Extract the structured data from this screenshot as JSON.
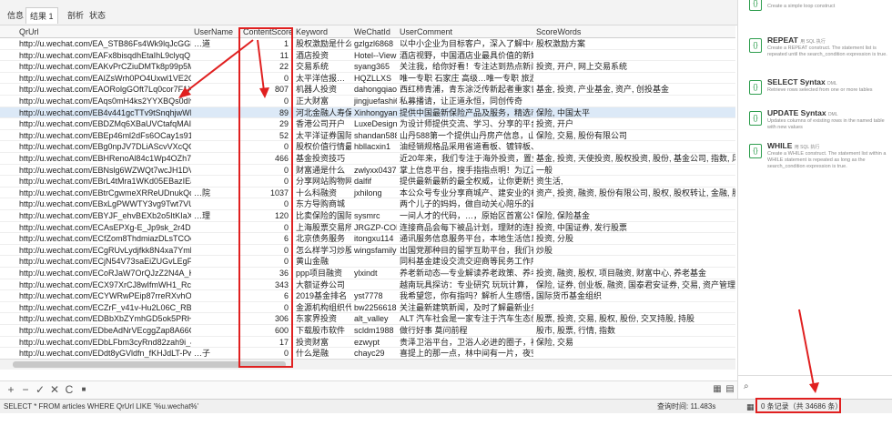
{
  "tabs": [
    "信息",
    "结果 1",
    "剖析",
    "状态"
  ],
  "active_tab": 1,
  "columns": {
    "qrurl": "QrUrl",
    "username": "UserName",
    "score": "ContentScore",
    "keyword": "Keyword",
    "wechatid": "WeChatId",
    "comment": "UserComment",
    "scorewords": "ScoreWords"
  },
  "rows": [
    {
      "url": "http://u.wechat.com/EA_STB86Fs4Wk9lqJcGGB0",
      "user": "…道",
      "score": "1",
      "kw": "股权激励是什么意思",
      "wc": "gzlgzl6868",
      "comment": "以中小企业为目标客户，深入了解中小企业在股权激",
      "sw": "股权激励方案"
    },
    {
      "url": "http://u.wechat.com/EAFx8bisqdhEtaIhL9clyqQ",
      "user": "",
      "score": "11",
      "kw": "酒店投资",
      "wc": "Hotel--View",
      "comment": "酒店视野，中国酒店业最具价值的新媒体，专注于投资",
      "sw": ""
    },
    {
      "url": "http://u.wechat.com/EAKvPrCZiuDMTk8p99p5MicU",
      "user": "",
      "score": "22",
      "kw": "交易系统",
      "wc": "syang365",
      "comment": "关注我，给你好看！专注达到热点新闻追踪与报道，投资",
      "sw": "投资, 开户, 网上交易系统"
    },
    {
      "url": "http://u.wechat.com/EAIZsWrh0PO4Uxwl1VE2OV4",
      "user": "",
      "score": "0",
      "kw": "太平洋信报…",
      "wc": "HQZLLXS",
      "comment": "唯一专职 石家庄 高级…唯一专职 旅游网，唯一专职 1",
      "sw": ""
    },
    {
      "url": "http://u.wechat.com/EAORolgGOft7Lq0cor7F1XU",
      "user": "",
      "score": "807",
      "kw": "机器人投资",
      "wc": "dahongqiao88",
      "comment": "西红柿青浦，青东涂泛传新起者重家青西及大红桥",
      "sw": "基金, 投资, 产业基金, 资产, 创投基金"
    },
    {
      "url": "http://u.wechat.com/EAqs0mH4ks2YYXBQs0dIvYZ8",
      "user": "",
      "score": "0",
      "kw": "正大财富",
      "wc": "jingjuefashi6868",
      "comment": "私募播请，让正道永恒，同创传奇",
      "sw": ""
    },
    {
      "url": "http://u.wechat.com/EB4v441gcTTv9tSnqhjwWPg",
      "user": "",
      "score": "89",
      "kw": "河北金融人寿保险有…",
      "wc": "Xinhongyan05",
      "comment": "提供中国最新保险产品及服务，精选市场佳作比较",
      "sw": "保险, 中国太平"
    },
    {
      "url": "http://u.wechat.com/EBDZMq6XBaUVCtafqMAI-Fg",
      "user": "",
      "score": "29",
      "kw": "香港公司开户",
      "wc": "LuxeDesign",
      "comment": "为设计师提供交流、学习、分享的平台，发现令人",
      "sw": "投资, 开户"
    },
    {
      "url": "http://u.wechat.com/EBEp46ml2dFs6OCay1s91o",
      "user": "",
      "score": "52",
      "kw": "太平洋证券国际投资",
      "wc": "shandan588",
      "comment": "山丹588第一个提供山丹房产信息，山丹招聘求职",
      "sw": "保险, 交易, 股份有限公司"
    },
    {
      "url": "http://u.wechat.com/EBg0npJV7DLiAScvVXcQOLA",
      "user": "",
      "score": "0",
      "kw": "股权价值行情最新报…",
      "wc": "hbllacxin1",
      "comment": "油经销规格品采用省道看板、镀锌板、铝镁、铜板、",
      "sw": ""
    },
    {
      "url": "http://u.wechat.com/EBHRenoAl84c1Wp4OZh7YaA",
      "user": "",
      "score": "466",
      "kw": "基金投资技巧",
      "wc": "",
      "comment": "近20年来，我们专注于海外投资，置业，移民领域",
      "sw": "基金, 投资, 天使投资, 股权投资, 股份, 基金公司, 指数, 风险投资, 投资基金"
    },
    {
      "url": "http://u.wechat.com/EBNslg6WZWQt7wcJH1DVS6w",
      "user": "",
      "score": "0",
      "kw": "财富通是什么",
      "wc": "zwlyxx0437",
      "comment": "掌上信息平台，搜手指指点明！为辽源百姓提供一",
      "sw": "一般"
    },
    {
      "url": "http://u.wechat.com/EBrL4tMra1WKd05EBazIEa0",
      "user": "",
      "score": "0",
      "kw": "分享网站购物网",
      "wc": "dalfif",
      "comment": "提供最新最新的最全权威，让你更新受更新的意",
      "sw": "资生活,"
    },
    {
      "url": "http://u.wechat.com/EBtrCgwmeXRReUDnukQqXb4",
      "user": "…院",
      "score": "1037",
      "kw": "十么科融资",
      "wc": "jxhilong",
      "comment": "本公众号专业分享商城产、建安业的相关知识！",
      "sw": "资产, 投资, 融资, 股份有限公司, 股权, 股权转让, 金融, 股权转让协议"
    },
    {
      "url": "http://u.wechat.com/EBxLgPWWTY3vg9Twt7VUtGc",
      "user": "",
      "score": "0",
      "kw": "东方导购商城",
      "wc": "",
      "comment": "两个儿子的妈妈，做自动关心陪乐的最新，也要…",
      "sw": ""
    },
    {
      "url": "http://u.wechat.com/EBYJF_ehvBEXb2o5ItKIaXk",
      "user": "…理",
      "score": "120",
      "kw": "比卖保险的国际投资",
      "wc": "sysmrc",
      "comment": "一间人才的代码，…，原始区首富公司及金国业务",
      "sw": "保险, 保险基金"
    },
    {
      "url": "http://u.wechat.com/ECAsEPXg-E_Jp9sk_2r4Dgc",
      "user": "",
      "score": "0",
      "kw": "上海股票交易所",
      "wc": "JRGZP-COM",
      "comment": "连接商品会每下被品计划，理财的连接投资机构，",
      "sw": "投资, 中国证券, 发行股票"
    },
    {
      "url": "http://u.wechat.com/ECfZom8ThdmiazDLsTCOojo",
      "user": "",
      "score": "6",
      "kw": "北京债务服务",
      "wc": "itongxu114",
      "comment": "通讯服务信息服务平台，本地生活信息发布！官方",
      "sw": "投资, 分股"
    },
    {
      "url": "http://u.wechat.com/ECgRUvLydjfkk8N4xa7Ymbw",
      "user": "",
      "score": "0",
      "kw": "怎么样学习炒股",
      "wc": "wingsfamily",
      "comment": "出国党那种目的留学互助平台，我们有料，有趣，",
      "sw": "炒股"
    },
    {
      "url": "http://u.wechat.com/ECjN54V73saEiZUGvLEgFVs",
      "user": "",
      "score": "0",
      "kw": "黄山金融",
      "wc": "",
      "comment": "同科基金建设交流交迎商等民务工作所中华民前发",
      "sw": ""
    },
    {
      "url": "http://u.wechat.com/ECoRJaW7OrQJzZ2N4A_K34",
      "user": "",
      "score": "36",
      "kw": "ppp项目融资",
      "wc": "ylxindt",
      "comment": "养老新动态—专业解读养老政策、养老产业最新",
      "sw": "投资, 融资, 股权, 项目融资, 财富中心, 养老基金"
    },
    {
      "url": "http://u.wechat.com/ECX97XrCJ8wIfmWH1_Rcpdl",
      "user": "",
      "score": "343",
      "kw": "大额证券公司",
      "wc": "",
      "comment": "越南玩具探访：专业研究 玩玩计算，",
      "sw": "保险, 证券, 创业板, 融资, 国泰君安证券, 交易, 资产管理, 股份, 指数"
    },
    {
      "url": "http://u.wechat.com/ECYWRwPEip87rreRXvhO8Ck",
      "user": "",
      "score": "6",
      "kw": "2019基金排名",
      "wc": "yst7778",
      "comment": "我希望您，你有指吗？解析人生感悟，让更多的人",
      "sw": "国际货币基金组织"
    },
    {
      "url": "http://u.wechat.com/ECZrF_v41v-Hu2L06C_RBHQ",
      "user": "",
      "score": "0",
      "kw": "金源机构组织代码查询",
      "wc": "bw2256618",
      "comment": "关注最新建筑新闻，及时了解最新业务政策和建议",
      "sw": ""
    },
    {
      "url": "http://u.wechat.com/EDBbXbZYmhGD5ok5PRHxcSQ",
      "user": "",
      "score": "306",
      "kw": "东家界投资",
      "wc": "alt_valley",
      "comment": "ALT 汽车社会是一家专注于汽车生态创业的孵化平",
      "sw": "股票, 投资, 交易, 股权, 股份, 交叉持股, 持股"
    },
    {
      "url": "http://u.wechat.com/EDbeAdNrVEcggZap8A66G10",
      "user": "",
      "score": "600",
      "kw": "下载股市软件",
      "wc": "scldm1988",
      "comment": "做行好事 莫问前程",
      "sw": "股市, 股票, 行情, 指数"
    },
    {
      "url": "http://u.wechat.com/EDbLFbm3cyRnd82zah9i_4Y",
      "user": "",
      "score": "17",
      "kw": "投资财富",
      "wc": "ezwypt",
      "comment": "贵泽卫浴平台，卫浴人必进的圈子，被需产，招代",
      "sw": "保险, 交易"
    },
    {
      "url": "http://u.wechat.com/EDdt8yGVldfn_fKHJdLT-Pw",
      "user": "…子",
      "score": "0",
      "kw": "什么是融",
      "wc": "chayc29",
      "comment": "喜提上的那一点，林中间有一片，夜空中的星一",
      "sw": ""
    },
    {
      "url": "http://u.wechat.com/EDeVRgPjjD1saV14SQ2ZDUM",
      "user": "",
      "score": "2377",
      "kw": "证券投资信托",
      "wc": "",
      "comment": "为朋友们提供理财资讯，详解理财理念，把脉理财",
      "sw": "保险, 投资, 融资, 证券公司, 股权投资, 资产管理, 信托公司, 大面积"
    }
  ],
  "selected_row": 6,
  "toolbar_buttons": [
    "+",
    "−",
    "✓",
    "✕",
    "C",
    "■"
  ],
  "status": {
    "sql": "SELECT * FROM articles WHERE QrUrl LIKE '%u.wechat%'",
    "query_time": "查询时间: 11.483s",
    "records": "0 条记录（共 34686 条）"
  },
  "snippets": [
    {
      "title": "REPEAT",
      "sub": "用 SQL 执行",
      "desc": "Create a REPEAT construct. The statement list is repeated until the search_condition expression is true."
    },
    {
      "title": "SELECT Syntax",
      "sub": "DML",
      "desc": "Retrieve rows selected from one or more tables"
    },
    {
      "title": "UPDATE Syntax",
      "sub": "DML",
      "desc": "Updates columns of existing rows in the named table with new values"
    },
    {
      "title": "WHILE",
      "sub": "用 SQL 执行",
      "desc": "Create a WHILE construct. The statement list within a WHILE statement is repeated as long as the search_condition expression is true."
    }
  ],
  "top_snippet_desc": "Create a simple loop construct",
  "colors": {
    "accent": "#2f9e4f",
    "highlight": "#e02020"
  }
}
